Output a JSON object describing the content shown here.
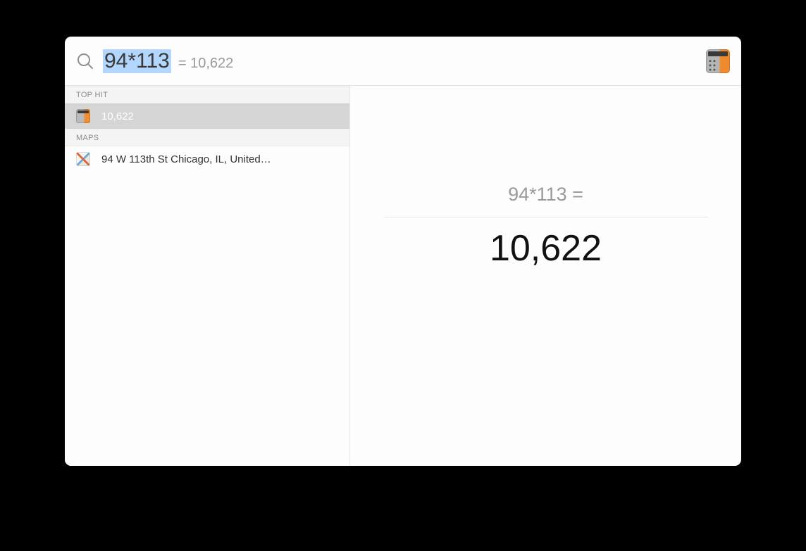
{
  "search": {
    "query": "94*113",
    "inline_result": "= 10,622"
  },
  "sidebar": {
    "sections": [
      {
        "header": "TOP HIT",
        "items": [
          {
            "icon": "calculator",
            "label": "10,622",
            "selected": true
          }
        ]
      },
      {
        "header": "MAPS",
        "items": [
          {
            "icon": "maps",
            "label": "94 W 113th St Chicago, IL, United…",
            "selected": false
          }
        ]
      }
    ]
  },
  "detail": {
    "expression": "94*113 =",
    "result": "10,622"
  }
}
